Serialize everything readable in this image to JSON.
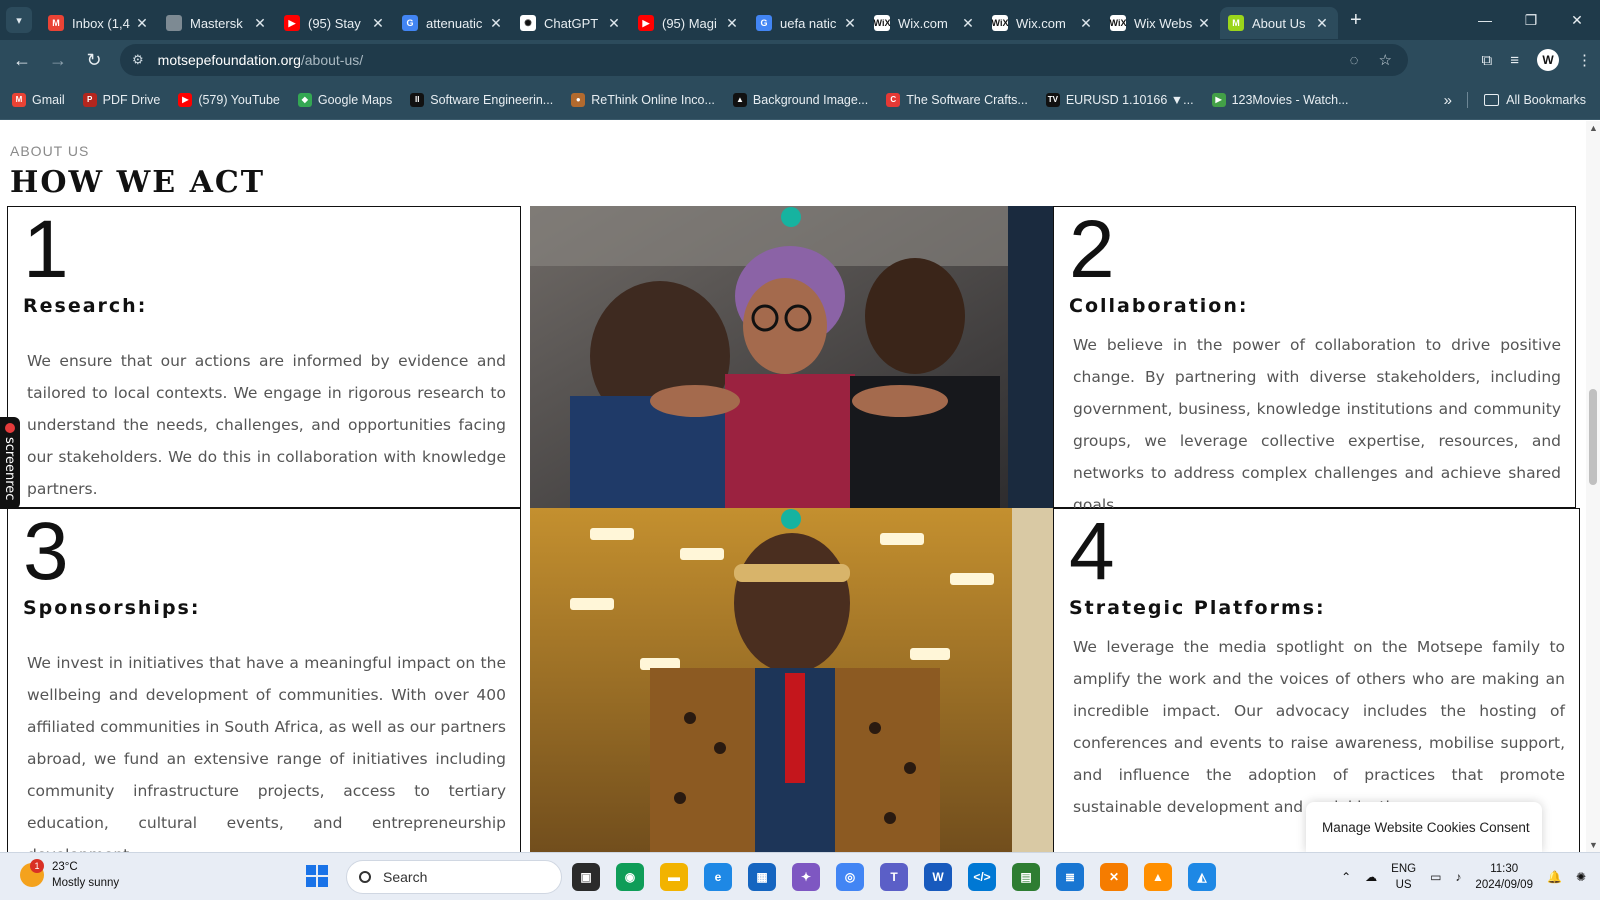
{
  "browser": {
    "tabs": [
      {
        "title": "Inbox (1,4",
        "icon": "gmail-icon",
        "color": "#ea4335",
        "glyph": "M"
      },
      {
        "title": "Mastersk",
        "icon": "globe-icon",
        "color": "#7d8a93",
        "glyph": ""
      },
      {
        "title": "(95) Stay",
        "icon": "youtube-icon",
        "color": "#ff0000",
        "glyph": "▶"
      },
      {
        "title": "attenuatic",
        "icon": "google-icon",
        "color": "#4285f4",
        "glyph": "G"
      },
      {
        "title": "ChatGPT",
        "icon": "chatgpt-icon",
        "color": "#ffffff",
        "glyph": "✺"
      },
      {
        "title": "(95) Magi",
        "icon": "youtube-icon",
        "color": "#ff0000",
        "glyph": "▶"
      },
      {
        "title": "uefa natic",
        "icon": "google-icon",
        "color": "#4285f4",
        "glyph": "G"
      },
      {
        "title": "Wix.com",
        "icon": "wix-icon",
        "color": "#ffffff",
        "glyph": "WiX"
      },
      {
        "title": "Wix.com",
        "icon": "wix-icon",
        "color": "#ffffff",
        "glyph": "WiX"
      },
      {
        "title": "Wix Webs",
        "icon": "wix-icon",
        "color": "#ffffff",
        "glyph": "WiX"
      },
      {
        "title": "About Us",
        "icon": "motsepe-icon",
        "color": "#9bd51b",
        "glyph": "M",
        "active": true
      }
    ],
    "url_host": "motsepefoundation.org",
    "url_path": "/about-us/",
    "bookmarks": [
      {
        "label": "Gmail",
        "icon": "gmail-icon",
        "color": "#ea4335",
        "glyph": "M"
      },
      {
        "label": "PDF Drive",
        "icon": "pdf-drive-icon",
        "color": "#b3261e",
        "glyph": "P"
      },
      {
        "label": "(579) YouTube",
        "icon": "youtube-icon",
        "color": "#ff0000",
        "glyph": "▶"
      },
      {
        "label": "Google Maps",
        "icon": "maps-icon",
        "color": "#34a853",
        "glyph": "◆"
      },
      {
        "label": "Software Engineerin...",
        "icon": "software-icon",
        "color": "#111111",
        "glyph": "II"
      },
      {
        "label": "ReThink Online Inco...",
        "icon": "rethink-icon",
        "color": "#b26a2e",
        "glyph": "●"
      },
      {
        "label": "Background Image...",
        "icon": "background-icon",
        "color": "#111111",
        "glyph": "▲"
      },
      {
        "label": "The Software Crafts...",
        "icon": "crafts-icon",
        "color": "#e53935",
        "glyph": "C"
      },
      {
        "label": "EURUSD 1.10166 ▼...",
        "icon": "tradingview-icon",
        "color": "#111111",
        "glyph": "TV"
      },
      {
        "label": "123Movies - Watch...",
        "icon": "movies-icon",
        "color": "#43a047",
        "glyph": "▶"
      }
    ],
    "all_bookmarks": "All Bookmarks"
  },
  "page": {
    "eyebrow": "ABOUT US",
    "heading": "HOW WE ACT",
    "cards": [
      {
        "number": "1",
        "title": "Research:",
        "body": "We ensure that our actions are informed by evidence and tailored to local contexts. We engage in rigorous research to understand the needs, challenges, and opportunities facing our stakeholders. We do this in collaboration with knowledge partners."
      },
      {
        "number": "2",
        "title": "Collaboration:",
        "body": "We believe in the power of collaboration to drive positive change. By partnering with diverse stakeholders, including government, business, knowledge institutions and community groups, we leverage collective expertise, resources, and networks to address complex challenges and achieve shared goals."
      },
      {
        "number": "3",
        "title": "Sponsorships:",
        "body": "We invest in initiatives that have a meaningful impact on the wellbeing and development of communities. With over 400 affiliated communities in South Africa, as well as our partners abroad, we fund an extensive range of initiatives including community infrastructure projects, access to tertiary education, cultural events, and entrepreneurship development."
      },
      {
        "number": "4",
        "title": "Strategic Platforms:",
        "body": "We leverage the media spotlight on the Motsepe family to amplify the work and the voices of others who are making an incredible impact. Our advocacy includes the hosting of conferences and events to raise awareness, mobilise support, and influence the adoption of practices that promote sustainable development and social justice."
      }
    ],
    "cookie_consent": "Manage Website Cookies Consent",
    "screenrec_label": "screenrec"
  },
  "taskbar": {
    "weather_temp": "23°C",
    "weather_desc": "Mostly sunny",
    "weather_badge": "1",
    "search_placeholder": "Search",
    "lang_top": "ENG",
    "lang_bottom": "US",
    "time": "11:30",
    "date": "2024/09/09"
  }
}
